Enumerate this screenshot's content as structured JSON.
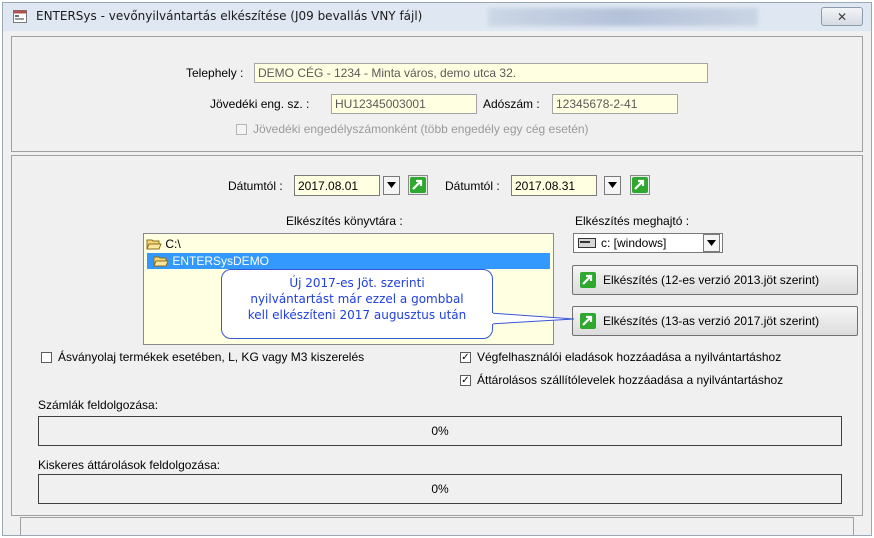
{
  "window": {
    "title": "ENTERSys - vevőnyilvántartás elkészítése (J09 bevallás VNY fájl)",
    "close_symbol": "✕"
  },
  "header": {
    "telephely_label": "Telephely :",
    "telephely_value": "DEMO CÉG - 1234 - Minta város, demo utca 32.",
    "jovedeki_label": "Jövedéki eng. sz. :",
    "jovedeki_value": "HU12345003001",
    "adoszam_label": "Adószám :",
    "adoszam_value": "12345678-2-41",
    "engedely_checkbox_label": "Jövedéki engedélyszámonként (több engedély egy cég esetén)"
  },
  "dates": {
    "from_label": "Dátumtól :",
    "from_value": "2017.08.01",
    "to_label": "Dátumtól :",
    "to_value": "2017.08.31"
  },
  "directory": {
    "label": "Elkészítés könyvtára :",
    "items": [
      "C:\\",
      "ENTERSysDEMO"
    ]
  },
  "drive": {
    "label": "Elkészítés meghajtó :",
    "value": "c: [windows]"
  },
  "buttons": {
    "v12": "Elkészítés (12-es verzió 2013.jöt szerint)",
    "v13": "Elkészítés (13-as verzió 2017.jöt szerint)"
  },
  "callout": {
    "line1": "Új 2017-es Jöt. szerinti",
    "line2": "nyilvántartást már ezzel a gombbal",
    "line3": "kell elkészíteni 2017 augusztus után"
  },
  "options": {
    "asvanyolaj": "Ásványolaj termékek esetében, L, KG vagy M3 kiszerelés",
    "vegfelhasznaloi": "Végfelhasználói eladások hozzáadása a nyilvántartáshoz",
    "attarolasos": "Áttárolásos szállítólevelek hozzáadása a nyilvántartáshoz",
    "check_mark": "✓"
  },
  "progress": {
    "szamlak_label": "Számlák feldolgozása:",
    "szamlak_value": "0%",
    "kiskeres_label": "Kiskeres áttárolások feldolgozása:",
    "kiskeres_value": "0%"
  },
  "colors": {
    "field_bg": "#ffffe1",
    "selected_bg": "#3399ff",
    "callout_text": "#1f3fe0",
    "green_icon": "#2fa82f"
  }
}
